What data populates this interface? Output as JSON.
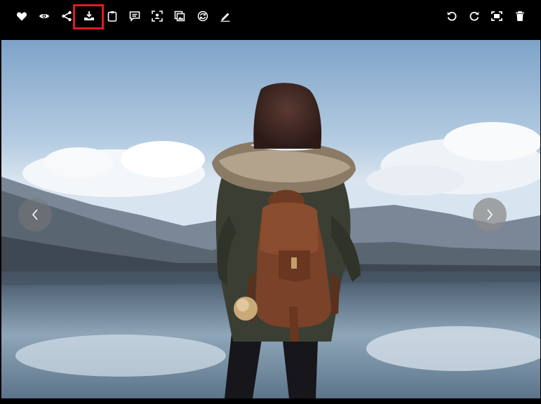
{
  "toolbar": {
    "left_actions": [
      {
        "name": "favorite",
        "icon": "heart-icon"
      },
      {
        "name": "preview",
        "icon": "eye-icon"
      },
      {
        "name": "share",
        "icon": "share-icon"
      },
      {
        "name": "download",
        "icon": "download-icon",
        "highlighted": true
      },
      {
        "name": "clipboard",
        "icon": "clipboard-icon"
      },
      {
        "name": "comment",
        "icon": "comment-icon"
      },
      {
        "name": "scan",
        "icon": "scan-icon"
      },
      {
        "name": "gallery",
        "icon": "image-stack-icon"
      },
      {
        "name": "convert",
        "icon": "refresh-icon"
      },
      {
        "name": "edit",
        "icon": "pencil-icon"
      }
    ],
    "right_actions": [
      {
        "name": "rotate-left",
        "icon": "rotate-left-icon"
      },
      {
        "name": "rotate-right",
        "icon": "rotate-right-icon"
      },
      {
        "name": "fit-screen",
        "icon": "fullscreen-icon"
      },
      {
        "name": "delete",
        "icon": "trash-icon"
      }
    ],
    "highlight_color": "#e01b24"
  },
  "viewer": {
    "image_subject": "woman-with-leather-backpack-by-lake",
    "prev_icon": "chevron-left-icon",
    "next_icon": "chevron-right-icon"
  },
  "colors": {
    "toolbar_bg": "#000000",
    "icon": "#ffffff",
    "nav_button": "#8c8c8c"
  }
}
